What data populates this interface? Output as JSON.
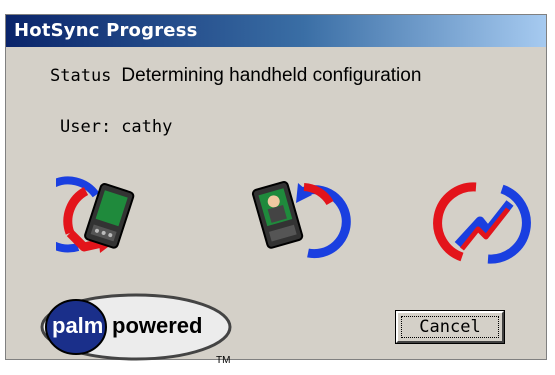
{
  "window": {
    "title": "HotSync Progress"
  },
  "status": {
    "label": "Status",
    "text": "Determining handheld configuration"
  },
  "user": {
    "label": "User:",
    "name": "cathy"
  },
  "icons": [
    "sync-arrows-handheld-icon",
    "sync-arrows-user-handheld-icon",
    "sync-connection-icon"
  ],
  "logo": {
    "brand": "palm",
    "text": "powered",
    "mark": "TM"
  },
  "buttons": {
    "cancel": "Cancel"
  },
  "colors": {
    "title_bar_start": "#0a246a",
    "title_bar_end": "#a6caf0",
    "dialog_bg": "#d4d0c8",
    "sync_red": "#e3141b",
    "sync_blue": "#1a3fe0",
    "handheld_green": "#1f8a3c"
  }
}
